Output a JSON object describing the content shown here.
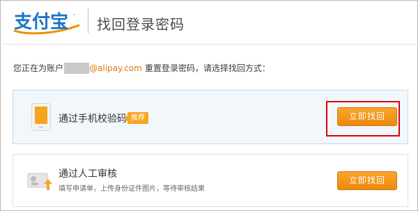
{
  "header": {
    "logo_text": "支付宝",
    "title": "找回登录密码"
  },
  "notice": {
    "prefix": "您正在为账户",
    "account_domain": "@alipay.com",
    "suffix": "重置登录密码，请选择找回方式："
  },
  "options": [
    {
      "label": "通过手机校验码",
      "badge": "推荐",
      "button_label": "立即找回",
      "icon": "phone-icon",
      "selected": true
    },
    {
      "label": "通过人工审核",
      "sublabel": "填写申请单，上传身份证件图片，等待审核结果",
      "button_label": "立即找回",
      "icon": "id-card-upload-icon",
      "selected": false
    }
  ],
  "colors": {
    "brand_blue": "#1c73c5",
    "brand_orange": "#f08c00",
    "button_orange": "#f39a1e",
    "highlight_red": "#e00000",
    "link_orange": "#e0780a"
  }
}
